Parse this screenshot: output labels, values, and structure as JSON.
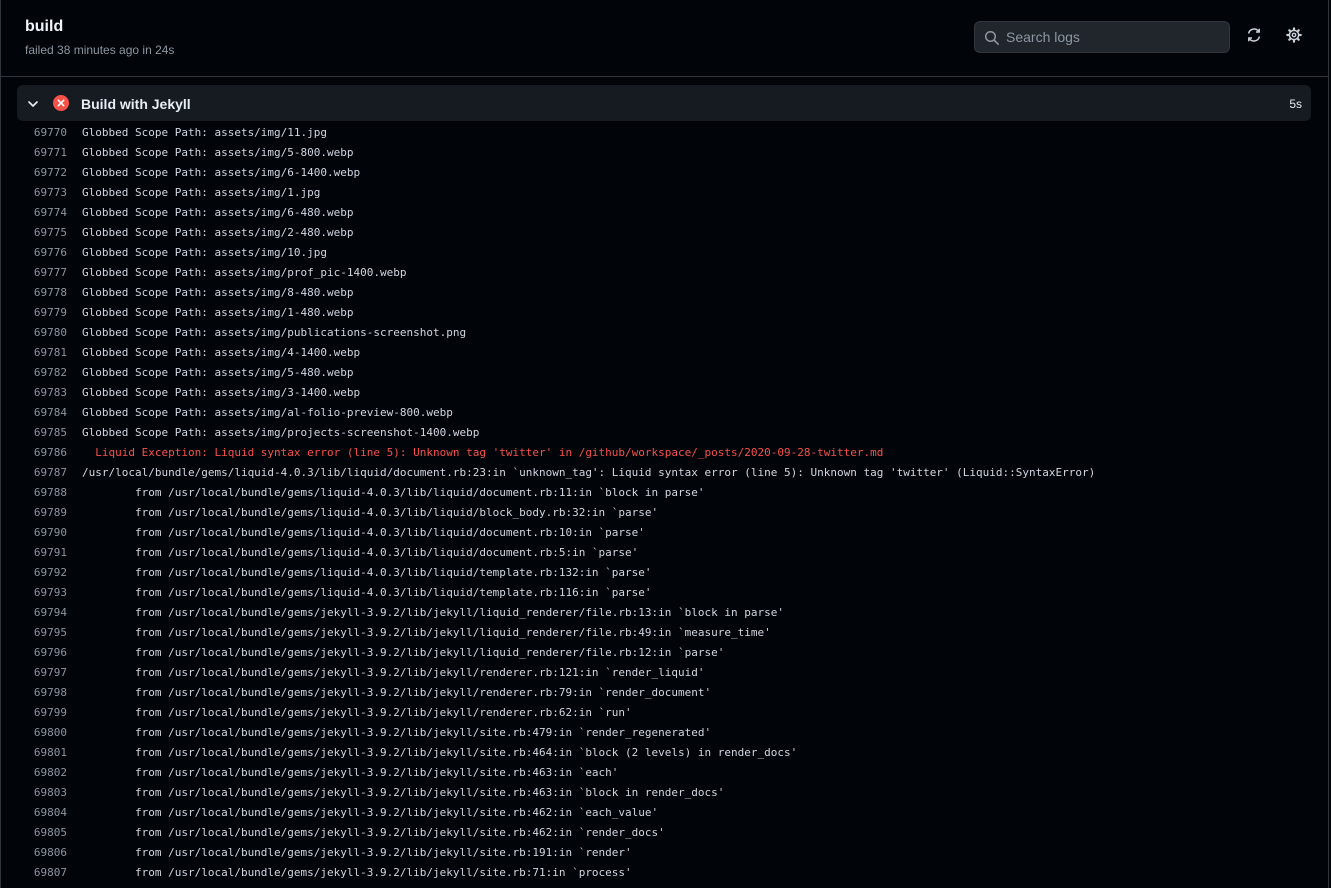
{
  "job": {
    "title": "build",
    "status": "failed 38 minutes ago in 24s"
  },
  "search": {
    "placeholder": "Search logs",
    "icon": "search-icon"
  },
  "header_actions": [
    "refresh-icon",
    "gear-icon"
  ],
  "step": {
    "title": "Build with Jekyll",
    "duration": "5s",
    "status": "failed",
    "status_color": "#f85149"
  },
  "colors": {
    "background": "#010409",
    "error_text": "#f85149",
    "line_number": "#8d96a0"
  },
  "log_lines": [
    {
      "num": "69770",
      "text": "Globbed Scope Path: assets/img/11.jpg"
    },
    {
      "num": "69771",
      "text": "Globbed Scope Path: assets/img/5-800.webp"
    },
    {
      "num": "69772",
      "text": "Globbed Scope Path: assets/img/6-1400.webp"
    },
    {
      "num": "69773",
      "text": "Globbed Scope Path: assets/img/1.jpg"
    },
    {
      "num": "69774",
      "text": "Globbed Scope Path: assets/img/6-480.webp"
    },
    {
      "num": "69775",
      "text": "Globbed Scope Path: assets/img/2-480.webp"
    },
    {
      "num": "69776",
      "text": "Globbed Scope Path: assets/img/10.jpg"
    },
    {
      "num": "69777",
      "text": "Globbed Scope Path: assets/img/prof_pic-1400.webp"
    },
    {
      "num": "69778",
      "text": "Globbed Scope Path: assets/img/8-480.webp"
    },
    {
      "num": "69779",
      "text": "Globbed Scope Path: assets/img/1-480.webp"
    },
    {
      "num": "69780",
      "text": "Globbed Scope Path: assets/img/publications-screenshot.png"
    },
    {
      "num": "69781",
      "text": "Globbed Scope Path: assets/img/4-1400.webp"
    },
    {
      "num": "69782",
      "text": "Globbed Scope Path: assets/img/5-480.webp"
    },
    {
      "num": "69783",
      "text": "Globbed Scope Path: assets/img/3-1400.webp"
    },
    {
      "num": "69784",
      "text": "Globbed Scope Path: assets/img/al-folio-preview-800.webp"
    },
    {
      "num": "69785",
      "text": "Globbed Scope Path: assets/img/projects-screenshot-1400.webp"
    },
    {
      "num": "69786",
      "text": "  Liquid Exception: Liquid syntax error (line 5): Unknown tag 'twitter' in /github/workspace/_posts/2020-09-28-twitter.md",
      "error": true
    },
    {
      "num": "69787",
      "text": "/usr/local/bundle/gems/liquid-4.0.3/lib/liquid/document.rb:23:in `unknown_tag': Liquid syntax error (line 5): Unknown tag 'twitter' (Liquid::SyntaxError)"
    },
    {
      "num": "69788",
      "text": "        from /usr/local/bundle/gems/liquid-4.0.3/lib/liquid/document.rb:11:in `block in parse'"
    },
    {
      "num": "69789",
      "text": "        from /usr/local/bundle/gems/liquid-4.0.3/lib/liquid/block_body.rb:32:in `parse'"
    },
    {
      "num": "69790",
      "text": "        from /usr/local/bundle/gems/liquid-4.0.3/lib/liquid/document.rb:10:in `parse'"
    },
    {
      "num": "69791",
      "text": "        from /usr/local/bundle/gems/liquid-4.0.3/lib/liquid/document.rb:5:in `parse'"
    },
    {
      "num": "69792",
      "text": "        from /usr/local/bundle/gems/liquid-4.0.3/lib/liquid/template.rb:132:in `parse'"
    },
    {
      "num": "69793",
      "text": "        from /usr/local/bundle/gems/liquid-4.0.3/lib/liquid/template.rb:116:in `parse'"
    },
    {
      "num": "69794",
      "text": "        from /usr/local/bundle/gems/jekyll-3.9.2/lib/jekyll/liquid_renderer/file.rb:13:in `block in parse'"
    },
    {
      "num": "69795",
      "text": "        from /usr/local/bundle/gems/jekyll-3.9.2/lib/jekyll/liquid_renderer/file.rb:49:in `measure_time'"
    },
    {
      "num": "69796",
      "text": "        from /usr/local/bundle/gems/jekyll-3.9.2/lib/jekyll/liquid_renderer/file.rb:12:in `parse'"
    },
    {
      "num": "69797",
      "text": "        from /usr/local/bundle/gems/jekyll-3.9.2/lib/jekyll/renderer.rb:121:in `render_liquid'"
    },
    {
      "num": "69798",
      "text": "        from /usr/local/bundle/gems/jekyll-3.9.2/lib/jekyll/renderer.rb:79:in `render_document'"
    },
    {
      "num": "69799",
      "text": "        from /usr/local/bundle/gems/jekyll-3.9.2/lib/jekyll/renderer.rb:62:in `run'"
    },
    {
      "num": "69800",
      "text": "        from /usr/local/bundle/gems/jekyll-3.9.2/lib/jekyll/site.rb:479:in `render_regenerated'"
    },
    {
      "num": "69801",
      "text": "        from /usr/local/bundle/gems/jekyll-3.9.2/lib/jekyll/site.rb:464:in `block (2 levels) in render_docs'"
    },
    {
      "num": "69802",
      "text": "        from /usr/local/bundle/gems/jekyll-3.9.2/lib/jekyll/site.rb:463:in `each'"
    },
    {
      "num": "69803",
      "text": "        from /usr/local/bundle/gems/jekyll-3.9.2/lib/jekyll/site.rb:463:in `block in render_docs'"
    },
    {
      "num": "69804",
      "text": "        from /usr/local/bundle/gems/jekyll-3.9.2/lib/jekyll/site.rb:462:in `each_value'"
    },
    {
      "num": "69805",
      "text": "        from /usr/local/bundle/gems/jekyll-3.9.2/lib/jekyll/site.rb:462:in `render_docs'"
    },
    {
      "num": "69806",
      "text": "        from /usr/local/bundle/gems/jekyll-3.9.2/lib/jekyll/site.rb:191:in `render'"
    },
    {
      "num": "69807",
      "text": "        from /usr/local/bundle/gems/jekyll-3.9.2/lib/jekyll/site.rb:71:in `process'"
    }
  ]
}
